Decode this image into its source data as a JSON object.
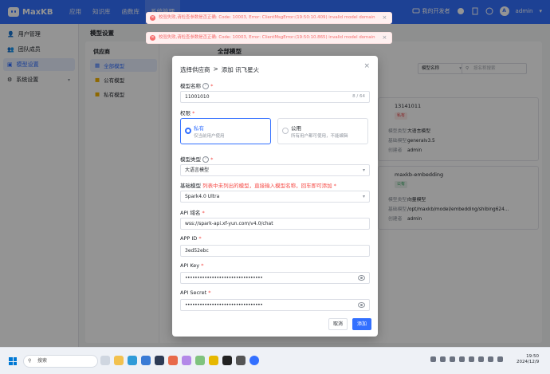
{
  "app": {
    "name": "MaxKB"
  },
  "nav": {
    "items": [
      "应用",
      "知识库",
      "函数库",
      "系统管理"
    ],
    "active_index": 3
  },
  "header": {
    "forum": "我的开发者",
    "user": "admin",
    "avatar_text": "A"
  },
  "sidebar": {
    "items": [
      {
        "label": "用户管理",
        "icon": "user-icon"
      },
      {
        "label": "团队成员",
        "icon": "team-icon"
      },
      {
        "label": "模型设置",
        "icon": "model-icon",
        "active": true
      },
      {
        "label": "系统设置",
        "icon": "gear-icon",
        "expandable": true
      }
    ]
  },
  "page": {
    "title": "模型设置"
  },
  "providers": {
    "title": "供应商",
    "items": [
      "全部模型",
      "公有模型",
      "私有模型"
    ]
  },
  "models": {
    "title": "全部模型",
    "sort_label": "模型名称",
    "search_placeholder": "按名称搜索",
    "cards": [
      {
        "name": "13141011",
        "tag": "私有",
        "rows": [
          {
            "k": "模型类型",
            "v": "大语言模型"
          },
          {
            "k": "基础模型",
            "v": "generalv3.5"
          },
          {
            "k": "创建者",
            "v": "admin"
          }
        ]
      },
      {
        "name": "maxkb-embedding",
        "tag": "公有",
        "rows": [
          {
            "k": "模型类型",
            "v": "向量模型"
          },
          {
            "k": "基础模型",
            "v": "/opt/maxkb/model/embedding/shibing624..."
          },
          {
            "k": "创建者",
            "v": "admin"
          }
        ]
      }
    ]
  },
  "toasts": [
    "校验失败,请检查参数是否正确: Code: 10003, Error: ClientMsgError:(19:50:10.409) invalid model domain",
    "校验失败,请检查参数是否正确: Code: 10003, Error: ClientMsgError:(19:50:10.865) invalid model domain"
  ],
  "dialog": {
    "breadcrumb_prev": "选择供应商",
    "sep": ">",
    "title": "添加 讯飞星火",
    "model_name": {
      "label": "模型名称",
      "value": "11001010",
      "count": "8 / 64"
    },
    "permission": {
      "label": "权限",
      "private": {
        "title": "私有",
        "desc": "仅当前用户使用"
      },
      "public": {
        "title": "公用",
        "desc": "所有用户都可使用，不能编辑"
      }
    },
    "model_type": {
      "label": "模型类型",
      "value": "大语言模型"
    },
    "base_model": {
      "label": "基础模型",
      "hint": "列表中未列出的模型，直接输入模型名称，回车即可添加",
      "value": "Spark4.0 Ultra"
    },
    "api_domain": {
      "label": "API 域名",
      "value": "wss://spark-api.xf-yun.com/v4.0/chat"
    },
    "app_id": {
      "label": "APP ID",
      "value": "3ed52ebc"
    },
    "api_key": {
      "label": "API Key",
      "value": "••••••••••••••••••••••••••••••••"
    },
    "api_secret": {
      "label": "API Secret",
      "value": "••••••••••••••••••••••••••••••••"
    },
    "cancel": "取消",
    "submit": "添加"
  },
  "taskbar": {
    "search": "搜索",
    "time": "19:50",
    "date": "2024/12/9"
  }
}
